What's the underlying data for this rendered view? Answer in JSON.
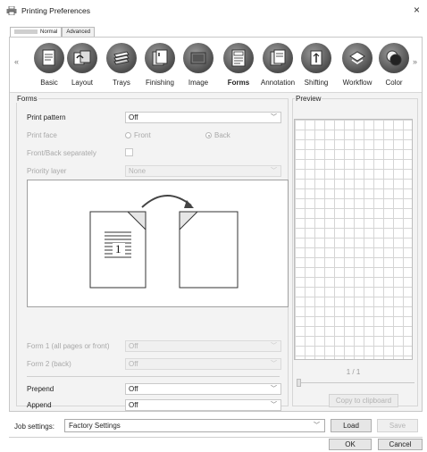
{
  "window": {
    "title": "Printing Preferences",
    "close_glyph": "×"
  },
  "tabs": [
    {
      "label": "Normal",
      "active": true
    },
    {
      "label": "Advanced",
      "active": false
    }
  ],
  "toolbar": {
    "scroll_left": "«",
    "scroll_right": "»",
    "items": [
      {
        "label": "Basic",
        "icon": "document-icon"
      },
      {
        "label": "Layout",
        "icon": "layout-icon"
      },
      {
        "label": "Trays",
        "icon": "trays-icon"
      },
      {
        "label": "Finishing",
        "icon": "finishing-icon"
      },
      {
        "label": "Image",
        "icon": "image-icon"
      },
      {
        "label": "Forms",
        "icon": "forms-icon",
        "active": true
      },
      {
        "label": "Annotation",
        "icon": "annotation-icon"
      },
      {
        "label": "Shifting",
        "icon": "shifting-icon"
      },
      {
        "label": "Workflow",
        "icon": "workflow-icon"
      },
      {
        "label": "Color",
        "icon": "color-icon"
      }
    ]
  },
  "forms": {
    "group_title": "Forms",
    "print_pattern": {
      "label": "Print pattern",
      "value": "Off"
    },
    "print_face": {
      "label": "Print face",
      "front": "Front",
      "back": "Back",
      "selected": "Back"
    },
    "front_back_separately": {
      "label": "Front/Back separately",
      "checked": false
    },
    "priority_layer": {
      "label": "Priority layer",
      "value": "None"
    },
    "preview_page_number": "1",
    "form1": {
      "label": "Form 1 (all pages or front)",
      "value": "Off"
    },
    "form2": {
      "label": "Form 2 (back)",
      "value": "Off"
    },
    "prepend": {
      "label": "Prepend",
      "value": "Off"
    },
    "append": {
      "label": "Append",
      "value": "Off"
    }
  },
  "preview": {
    "title": "Preview",
    "page_indicator": "1 / 1",
    "copy_button": "Copy to clipboard"
  },
  "bottom": {
    "job_settings_label": "Job settings:",
    "job_settings_value": "Factory Settings",
    "load": "Load",
    "save": "Save",
    "ok": "OK",
    "cancel": "Cancel"
  }
}
